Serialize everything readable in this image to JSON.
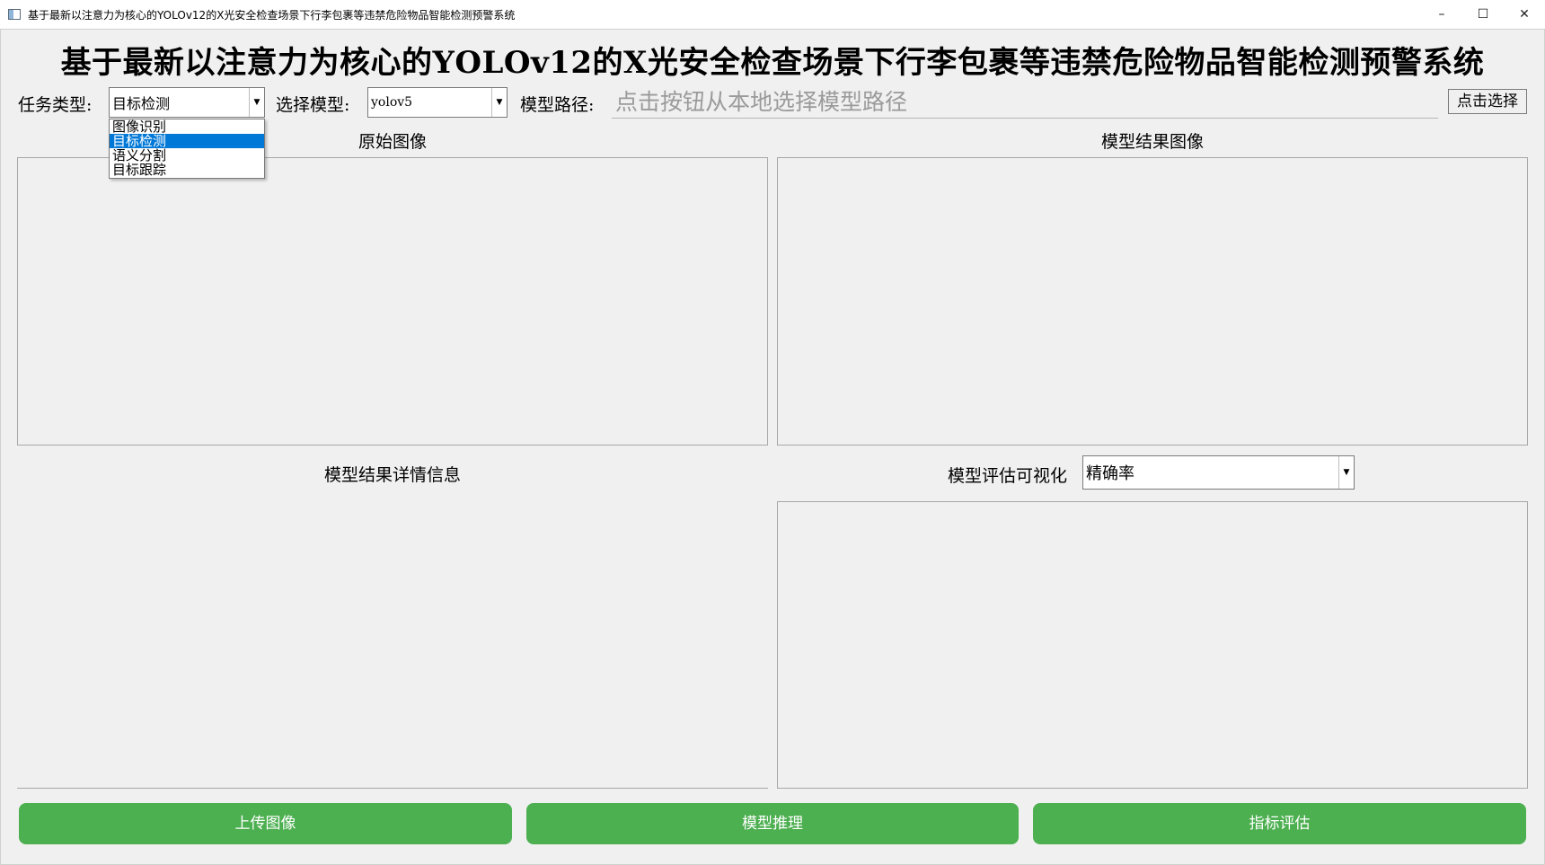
{
  "window": {
    "title": "基于最新以注意力为核心的YOLOv12的X光安全检查场景下行李包裹等违禁危险物品智能检测预警系统",
    "controls": [
      "minimize-icon",
      "maximize-icon",
      "close-icon"
    ]
  },
  "heading": "基于最新以注意力为核心的YOLOv12的X光安全检查场景下行李包裹等违禁危险物品智能检测预警系统",
  "toolbar": {
    "task_label": "任务类型:",
    "task_value": "目标检测",
    "task_options": [
      "图像识别",
      "目标检测",
      "语义分割",
      "目标跟踪"
    ],
    "task_selected_index": 1,
    "model_label": "选择模型:",
    "model_value": "yolov5",
    "path_label": "模型路径:",
    "path_placeholder": "点击按钮从本地选择模型路径",
    "pick_button": "点击选择"
  },
  "panels": {
    "original_title": "原始图像",
    "result_title": "模型结果图像",
    "details_title": "模型结果详情信息",
    "eval_label": "模型评估可视化",
    "eval_value": "精确率"
  },
  "buttons": {
    "upload": "上传图像",
    "infer": "模型推理",
    "evaluate": "指标评估"
  },
  "colors": {
    "button_green": "#4caf50",
    "selection_blue": "#0078d7"
  }
}
